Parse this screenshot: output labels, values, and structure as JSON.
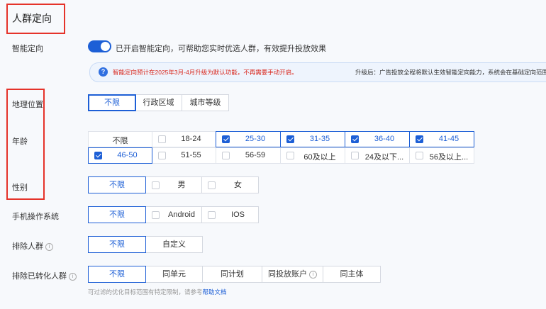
{
  "section_title": "人群定向",
  "smart": {
    "label": "智能定向",
    "toggle_text": "已开启智能定向，可帮助您实时优选人群，有效提升投放效果"
  },
  "notice": {
    "red_text": "智能定向预计在2025年3月-4月升级为默认功能，不再需要手动开启。",
    "black_text": "升级后：广告投放全程将默认生效智能定向能力，系统会在基础定向范围内，结合涨粉"
  },
  "geo": {
    "label": "地理位置",
    "options": [
      "不限",
      "行政区域",
      "城市等级"
    ],
    "selected": 0
  },
  "age": {
    "label": "年龄",
    "options": [
      {
        "text": "不限",
        "checked": false
      },
      {
        "text": "18-24",
        "checked": false
      },
      {
        "text": "25-30",
        "checked": true
      },
      {
        "text": "31-35",
        "checked": true
      },
      {
        "text": "36-40",
        "checked": true
      },
      {
        "text": "41-45",
        "checked": true
      },
      {
        "text": "46-50",
        "checked": true
      },
      {
        "text": "51-55",
        "checked": false
      },
      {
        "text": "56-59",
        "checked": false
      },
      {
        "text": "60及以上",
        "checked": false
      },
      {
        "text": "24及以下...",
        "checked": false
      },
      {
        "text": "56及以上...",
        "checked": false
      }
    ]
  },
  "gender": {
    "label": "性别",
    "options": [
      "不限",
      "男",
      "女"
    ],
    "selected": 0
  },
  "os": {
    "label": "手机操作系统",
    "options": [
      "不限",
      "Android",
      "IOS"
    ],
    "selected": 0
  },
  "exclude": {
    "label": "排除人群",
    "options": [
      "不限",
      "自定义"
    ],
    "selected": 0
  },
  "exclude_converted": {
    "label": "排除已转化人群",
    "options": [
      "不限",
      "同单元",
      "同计划",
      "同投放账户",
      "同主体"
    ],
    "selected": 0
  },
  "hint": {
    "text": "可过滤的优化目标范围有特定限制，请参考",
    "link": "帮助文档"
  },
  "colors": {
    "accent": "#1d5fd6",
    "highlight_box": "#e5332a",
    "notice_red": "#d9281e"
  }
}
